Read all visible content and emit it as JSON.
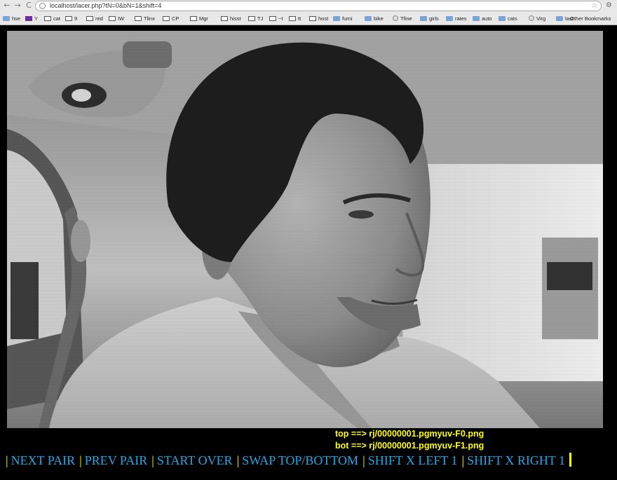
{
  "browser": {
    "url": "localhost/lacer.php?tN=0&bN=1&shift=4",
    "bookmarks": [
      {
        "label": "hse",
        "icon": "folder-icon"
      },
      {
        "label": "Y",
        "icon": "yahoo-icon"
      },
      {
        "label": "cat",
        "icon": "page-icon"
      },
      {
        "label": "9",
        "icon": "page-icon"
      },
      {
        "label": "red",
        "icon": "page-icon"
      },
      {
        "label": "IW",
        "icon": "page-icon"
      },
      {
        "label": "Tlinx",
        "icon": "page-icon"
      },
      {
        "label": "CP",
        "icon": "page-icon"
      },
      {
        "label": "Mgr",
        "icon": "page-icon"
      },
      {
        "label": "hisst",
        "icon": "page-icon"
      },
      {
        "label": "TJ",
        "icon": "page-icon"
      },
      {
        "label": "~t",
        "icon": "page-icon"
      },
      {
        "label": "tt",
        "icon": "page-icon"
      },
      {
        "label": "host",
        "icon": "page-icon"
      },
      {
        "label": "furni",
        "icon": "folder-icon"
      },
      {
        "label": "bike",
        "icon": "folder-icon"
      },
      {
        "label": "Tfine",
        "icon": "globe-icon"
      },
      {
        "label": "girls",
        "icon": "folder-icon"
      },
      {
        "label": "rates",
        "icon": "folder-icon"
      },
      {
        "label": "auto",
        "icon": "folder-icon"
      },
      {
        "label": "cats",
        "icon": "folder-icon"
      },
      {
        "label": "Virg",
        "icon": "globe-icon"
      },
      {
        "label": "last",
        "icon": "folder-icon"
      }
    ],
    "other_bookmarks": "Other Bookmarks"
  },
  "captions": {
    "top": "top ==> rj/00000001.pgmyuv-F0.png",
    "bot": "bot ==> rj/00000001.pgmyuv-F1.png"
  },
  "controls": {
    "separator": "|",
    "next_pair": "NEXT PAIR",
    "prev_pair": "PREV PAIR",
    "start_over": "START OVER",
    "swap": "SWAP TOP/BOTTOM",
    "shift_left": "SHIFT X LEFT 1",
    "shift_right": "SHIFT X RIGHT 1"
  },
  "colors": {
    "caption": "#ffff00",
    "link": "#1fa8e8",
    "background": "#000000"
  }
}
